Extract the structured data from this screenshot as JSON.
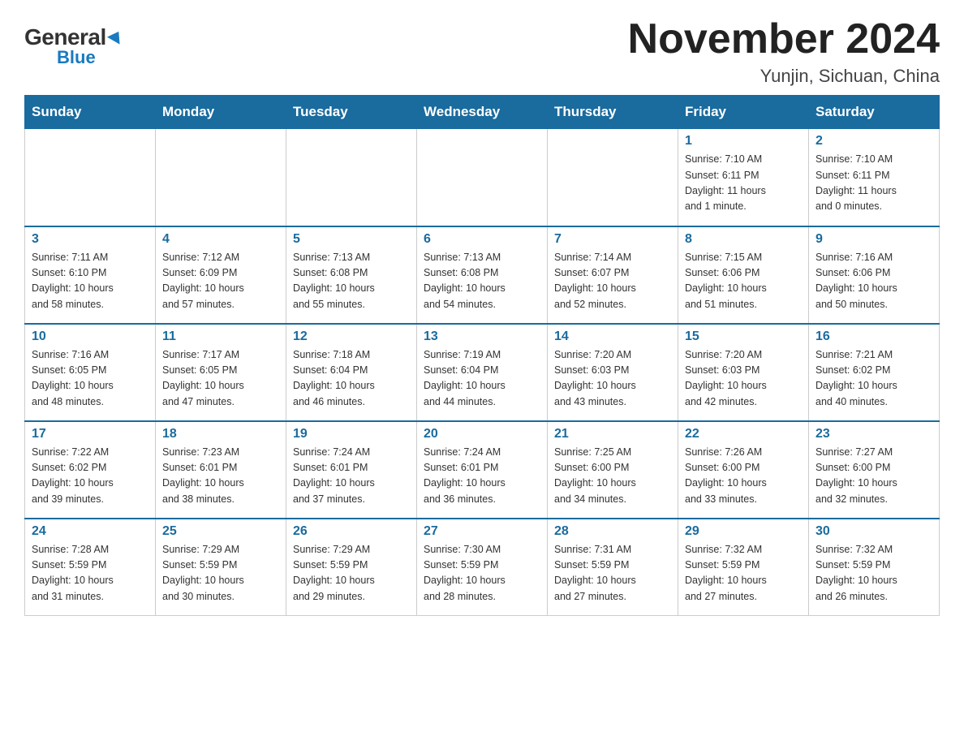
{
  "logo": {
    "general": "General",
    "blue": "Blue",
    "triangle": "▶"
  },
  "title": "November 2024",
  "location": "Yunjin, Sichuan, China",
  "days_of_week": [
    "Sunday",
    "Monday",
    "Tuesday",
    "Wednesday",
    "Thursday",
    "Friday",
    "Saturday"
  ],
  "weeks": [
    [
      {
        "day": "",
        "info": ""
      },
      {
        "day": "",
        "info": ""
      },
      {
        "day": "",
        "info": ""
      },
      {
        "day": "",
        "info": ""
      },
      {
        "day": "",
        "info": ""
      },
      {
        "day": "1",
        "info": "Sunrise: 7:10 AM\nSunset: 6:11 PM\nDaylight: 11 hours\nand 1 minute."
      },
      {
        "day": "2",
        "info": "Sunrise: 7:10 AM\nSunset: 6:11 PM\nDaylight: 11 hours\nand 0 minutes."
      }
    ],
    [
      {
        "day": "3",
        "info": "Sunrise: 7:11 AM\nSunset: 6:10 PM\nDaylight: 10 hours\nand 58 minutes."
      },
      {
        "day": "4",
        "info": "Sunrise: 7:12 AM\nSunset: 6:09 PM\nDaylight: 10 hours\nand 57 minutes."
      },
      {
        "day": "5",
        "info": "Sunrise: 7:13 AM\nSunset: 6:08 PM\nDaylight: 10 hours\nand 55 minutes."
      },
      {
        "day": "6",
        "info": "Sunrise: 7:13 AM\nSunset: 6:08 PM\nDaylight: 10 hours\nand 54 minutes."
      },
      {
        "day": "7",
        "info": "Sunrise: 7:14 AM\nSunset: 6:07 PM\nDaylight: 10 hours\nand 52 minutes."
      },
      {
        "day": "8",
        "info": "Sunrise: 7:15 AM\nSunset: 6:06 PM\nDaylight: 10 hours\nand 51 minutes."
      },
      {
        "day": "9",
        "info": "Sunrise: 7:16 AM\nSunset: 6:06 PM\nDaylight: 10 hours\nand 50 minutes."
      }
    ],
    [
      {
        "day": "10",
        "info": "Sunrise: 7:16 AM\nSunset: 6:05 PM\nDaylight: 10 hours\nand 48 minutes."
      },
      {
        "day": "11",
        "info": "Sunrise: 7:17 AM\nSunset: 6:05 PM\nDaylight: 10 hours\nand 47 minutes."
      },
      {
        "day": "12",
        "info": "Sunrise: 7:18 AM\nSunset: 6:04 PM\nDaylight: 10 hours\nand 46 minutes."
      },
      {
        "day": "13",
        "info": "Sunrise: 7:19 AM\nSunset: 6:04 PM\nDaylight: 10 hours\nand 44 minutes."
      },
      {
        "day": "14",
        "info": "Sunrise: 7:20 AM\nSunset: 6:03 PM\nDaylight: 10 hours\nand 43 minutes."
      },
      {
        "day": "15",
        "info": "Sunrise: 7:20 AM\nSunset: 6:03 PM\nDaylight: 10 hours\nand 42 minutes."
      },
      {
        "day": "16",
        "info": "Sunrise: 7:21 AM\nSunset: 6:02 PM\nDaylight: 10 hours\nand 40 minutes."
      }
    ],
    [
      {
        "day": "17",
        "info": "Sunrise: 7:22 AM\nSunset: 6:02 PM\nDaylight: 10 hours\nand 39 minutes."
      },
      {
        "day": "18",
        "info": "Sunrise: 7:23 AM\nSunset: 6:01 PM\nDaylight: 10 hours\nand 38 minutes."
      },
      {
        "day": "19",
        "info": "Sunrise: 7:24 AM\nSunset: 6:01 PM\nDaylight: 10 hours\nand 37 minutes."
      },
      {
        "day": "20",
        "info": "Sunrise: 7:24 AM\nSunset: 6:01 PM\nDaylight: 10 hours\nand 36 minutes."
      },
      {
        "day": "21",
        "info": "Sunrise: 7:25 AM\nSunset: 6:00 PM\nDaylight: 10 hours\nand 34 minutes."
      },
      {
        "day": "22",
        "info": "Sunrise: 7:26 AM\nSunset: 6:00 PM\nDaylight: 10 hours\nand 33 minutes."
      },
      {
        "day": "23",
        "info": "Sunrise: 7:27 AM\nSunset: 6:00 PM\nDaylight: 10 hours\nand 32 minutes."
      }
    ],
    [
      {
        "day": "24",
        "info": "Sunrise: 7:28 AM\nSunset: 5:59 PM\nDaylight: 10 hours\nand 31 minutes."
      },
      {
        "day": "25",
        "info": "Sunrise: 7:29 AM\nSunset: 5:59 PM\nDaylight: 10 hours\nand 30 minutes."
      },
      {
        "day": "26",
        "info": "Sunrise: 7:29 AM\nSunset: 5:59 PM\nDaylight: 10 hours\nand 29 minutes."
      },
      {
        "day": "27",
        "info": "Sunrise: 7:30 AM\nSunset: 5:59 PM\nDaylight: 10 hours\nand 28 minutes."
      },
      {
        "day": "28",
        "info": "Sunrise: 7:31 AM\nSunset: 5:59 PM\nDaylight: 10 hours\nand 27 minutes."
      },
      {
        "day": "29",
        "info": "Sunrise: 7:32 AM\nSunset: 5:59 PM\nDaylight: 10 hours\nand 27 minutes."
      },
      {
        "day": "30",
        "info": "Sunrise: 7:32 AM\nSunset: 5:59 PM\nDaylight: 10 hours\nand 26 minutes."
      }
    ]
  ]
}
